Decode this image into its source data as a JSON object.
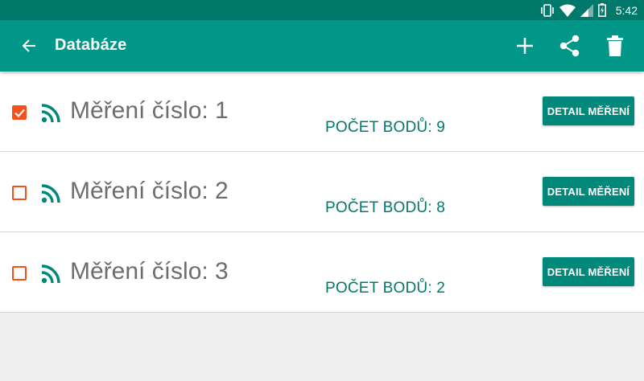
{
  "status_bar": {
    "time": "5:42",
    "icons": [
      "vibrate-icon",
      "wifi-icon",
      "signal-icon",
      "battery-charging-icon"
    ]
  },
  "app_bar": {
    "title": "Databáze",
    "actions": [
      "back-arrow-icon",
      "add-icon",
      "share-icon",
      "delete-icon"
    ]
  },
  "colors": {
    "app_bar": "#009688",
    "status_bar": "#00796b",
    "accent": "#f4511e",
    "button": "#00897b"
  },
  "measurements": [
    {
      "title": "Měření číslo: 1",
      "points": "POČET BODŮ: 9",
      "checked": true,
      "button": "DETAIL MĚŘENÍ"
    },
    {
      "title": "Měření číslo: 2",
      "points": "POČET BODŮ: 8",
      "checked": false,
      "button": "DETAIL MĚŘENÍ"
    },
    {
      "title": "Měření číslo: 3",
      "points": "POČET BODŮ: 2",
      "checked": false,
      "button": "DETAIL MĚŘENÍ"
    }
  ]
}
